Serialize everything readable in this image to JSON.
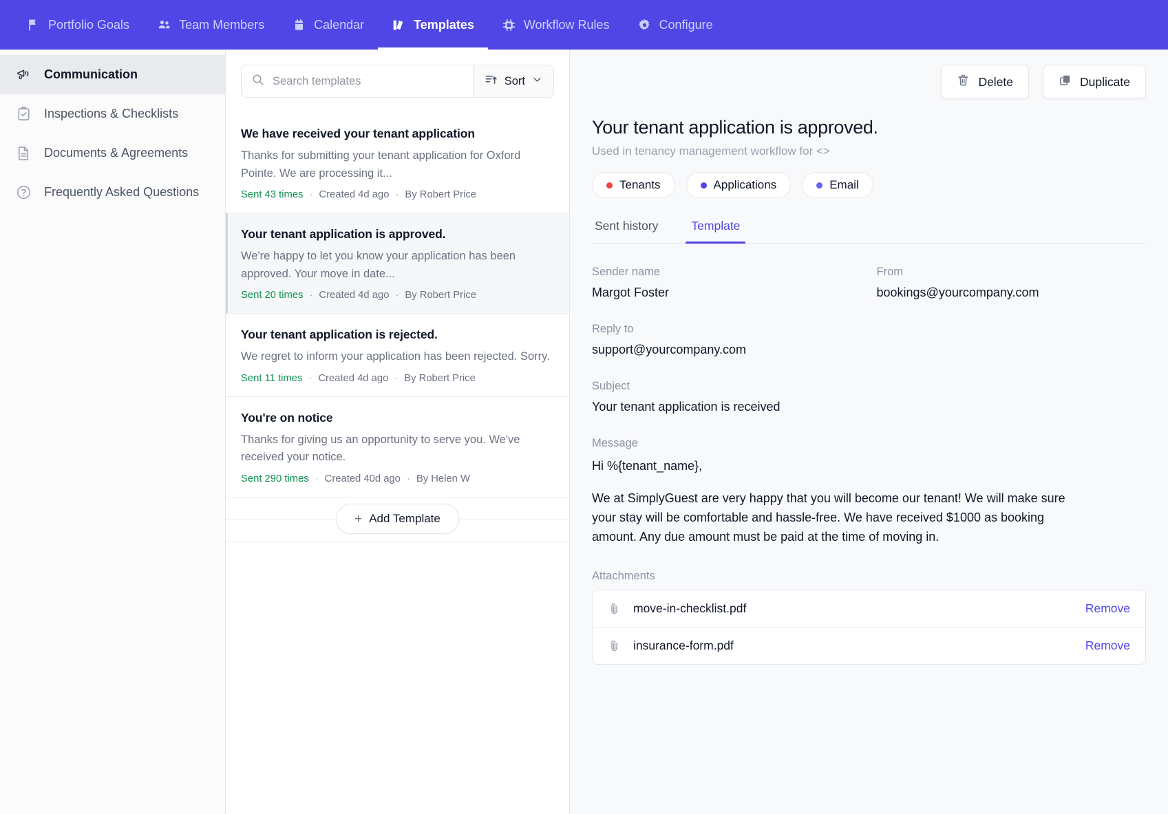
{
  "topnav": {
    "items": [
      {
        "label": "Portfolio Goals",
        "icon": "flag-icon",
        "active": false
      },
      {
        "label": "Team Members",
        "icon": "people-icon",
        "active": false
      },
      {
        "label": "Calendar",
        "icon": "calendar-icon",
        "active": false
      },
      {
        "label": "Templates",
        "icon": "templates-icon",
        "active": true
      },
      {
        "label": "Workflow Rules",
        "icon": "chip-icon",
        "active": false
      },
      {
        "label": "Configure",
        "icon": "gear-icon",
        "active": false
      }
    ],
    "accent_color": "#4F46E5"
  },
  "sidebar": {
    "items": [
      {
        "label": "Communication",
        "icon": "megaphone-icon",
        "active": true
      },
      {
        "label": "Inspections & Checklists",
        "icon": "clipboard-check-icon",
        "active": false
      },
      {
        "label": "Documents & Agreements",
        "icon": "document-icon",
        "active": false
      },
      {
        "label": "Frequently Asked Questions",
        "icon": "question-circle-icon",
        "active": false
      }
    ]
  },
  "list_panel": {
    "search": {
      "value": "",
      "placeholder": "Search templates"
    },
    "sort_label": "Sort",
    "add_template_label": "Add Template",
    "templates": [
      {
        "title": "We have received your tenant application",
        "description": "Thanks for submitting your tenant application for Oxford Pointe. We are processing it...",
        "sent": "Sent 43 times",
        "created": "Created 4d ago",
        "author": "By Robert Price",
        "selected": false
      },
      {
        "title": "Your tenant application is approved.",
        "description": "We're happy to let you know your application has been approved. Your move in date...",
        "sent": "Sent 20 times",
        "created": "Created 4d ago",
        "author": "By Robert Price",
        "selected": true
      },
      {
        "title": "Your tenant application is rejected.",
        "description": "We regret to inform your application has been rejected. Sorry.",
        "sent": "Sent 11 times",
        "created": "Created 4d ago",
        "author": "By Robert Price",
        "selected": false
      },
      {
        "title": "You're on notice",
        "description": "Thanks for giving us an opportunity to serve you. We've received your notice.",
        "sent": "Sent 290 times",
        "created": "Created 40d ago",
        "author": "By Helen W",
        "selected": false
      }
    ],
    "separator": "·"
  },
  "detail": {
    "delete_label": "Delete",
    "duplicate_label": "Duplicate",
    "title": "Your tenant application is approved.",
    "subtitle": "Used in tenancy management workflow for <>",
    "tags": [
      {
        "label": "Tenants",
        "dot_color": "#EF4444"
      },
      {
        "label": "Applications",
        "dot_color": "#4F46E5"
      },
      {
        "label": "Email",
        "dot_color": "#6366F1"
      }
    ],
    "tabs": [
      {
        "label": "Sent history",
        "active": false
      },
      {
        "label": "Template",
        "active": true
      }
    ],
    "fields": {
      "sender_name_label": "Sender name",
      "sender_name_value": "Margot Foster",
      "from_label": "From",
      "from_value": "bookings@yourcompany.com",
      "reply_to_label": "Reply to",
      "reply_to_value": "support@yourcompany.com",
      "subject_label": "Subject",
      "subject_value": "Your tenant application is received",
      "message_label": "Message",
      "message_greeting": "Hi %{tenant_name},",
      "message_body": "We at SimplyGuest are very happy that you will become our tenant! We will make sure your stay will be comfortable and hassle-free. We have received $1000 as booking amount. Any due amount must be paid at the time of moving in."
    },
    "attachments_label": "Attachments",
    "attachments": [
      {
        "name": "move-in-checklist.pdf",
        "remove_label": "Remove"
      },
      {
        "name": "insurance-form.pdf",
        "remove_label": "Remove"
      }
    ]
  }
}
